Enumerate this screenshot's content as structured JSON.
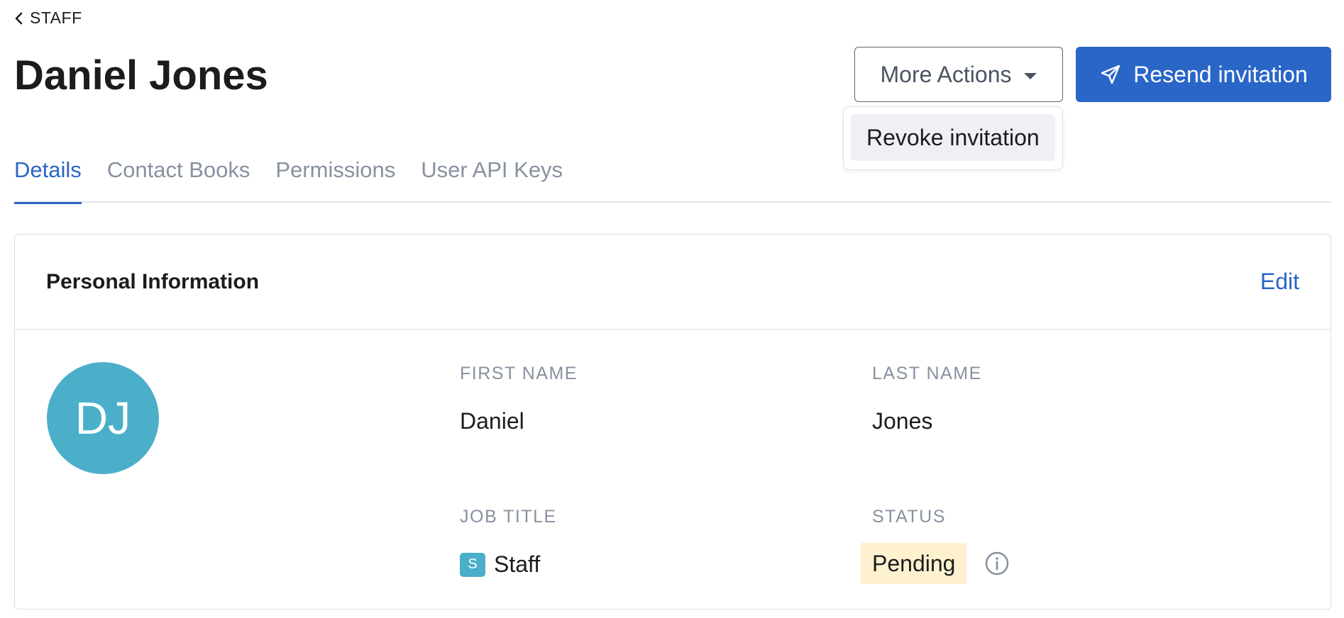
{
  "breadcrumb": {
    "label": "STAFF"
  },
  "header": {
    "title": "Daniel Jones",
    "more_actions_label": "More Actions",
    "resend_label": "Resend invitation"
  },
  "dropdown": {
    "items": [
      {
        "label": "Revoke invitation"
      }
    ]
  },
  "tabs": [
    {
      "label": "Details",
      "active": true
    },
    {
      "label": "Contact Books",
      "active": false
    },
    {
      "label": "Permissions",
      "active": false
    },
    {
      "label": "User API Keys",
      "active": false
    }
  ],
  "card": {
    "title": "Personal Information",
    "edit_label": "Edit",
    "avatar_initials": "DJ",
    "fields": {
      "first_name": {
        "label": "FIRST NAME",
        "value": "Daniel"
      },
      "last_name": {
        "label": "LAST NAME",
        "value": "Jones"
      },
      "job_title": {
        "label": "JOB TITLE",
        "badge": "S",
        "value": "Staff"
      },
      "status": {
        "label": "STATUS",
        "value": "Pending"
      }
    }
  },
  "colors": {
    "primary": "#2a66c7",
    "avatar": "#4bafc9",
    "pending_bg": "#fdf1cf",
    "muted_text": "#8791a0"
  },
  "icons": {
    "back": "chevron-left-icon",
    "caret": "caret-down-icon",
    "send": "send-icon",
    "info": "info-icon"
  }
}
